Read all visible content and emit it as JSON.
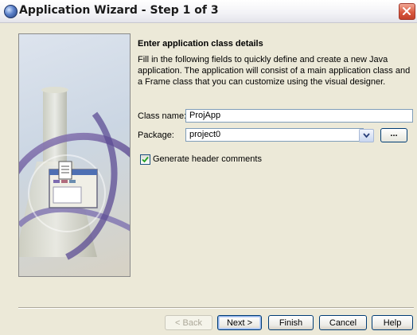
{
  "window": {
    "title": "Application Wizard - Step 1 of 3"
  },
  "content": {
    "heading": "Enter application class details",
    "description": "Fill in the following fields to quickly define and create a new Java application. The application will consist of a main application class and a Frame class that you can customize using the visual designer."
  },
  "form": {
    "class_name_label": "Class name:",
    "class_name_value": "ProjApp",
    "package_label": "Package:",
    "package_value": "project0",
    "browse_label": "...",
    "generate_comments_label": "Generate header comments",
    "generate_comments_checked": true
  },
  "buttons": {
    "back": "< Back",
    "next": "Next >",
    "finish": "Finish",
    "cancel": "Cancel",
    "help": "Help"
  },
  "colors": {
    "window_bg": "#ece9d8",
    "field_border": "#7f9db9",
    "close_button": "#d95a40",
    "check_green": "#21a121"
  },
  "icons": {
    "title": "wizard-app-icon",
    "close": "close-icon",
    "dropdown": "chevron-down-icon",
    "check": "checkmark-icon",
    "illustration": "application-illustration"
  }
}
